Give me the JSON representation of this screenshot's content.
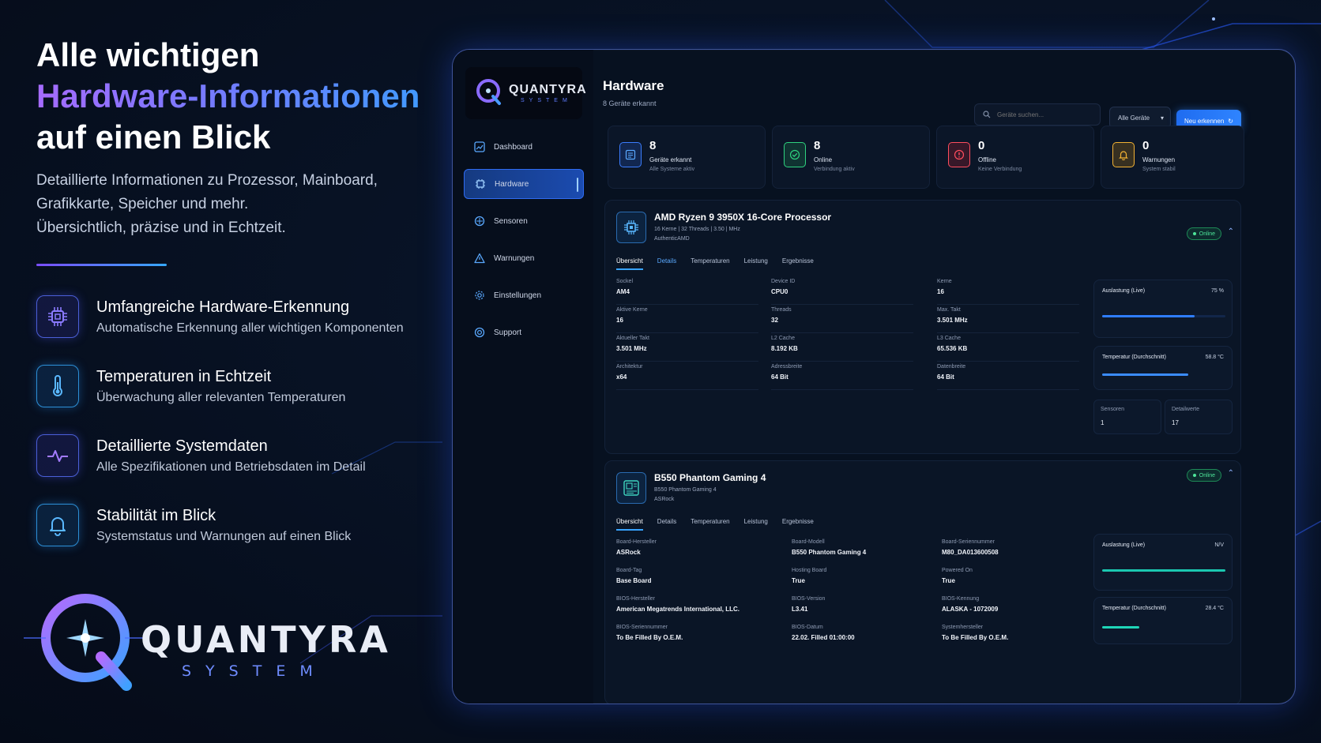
{
  "hero": {
    "line1": "Alle wichtigen",
    "line2": "Hardware-Informationen",
    "line3": "auf einen Blick",
    "sub1": "Detaillierte Informationen zu Prozessor, Mainboard,",
    "sub2": "Grafikkarte, Speicher und mehr.",
    "sub3": "Übersichtlich, präzise und in Echtzeit."
  },
  "features": [
    {
      "icon": "cpu-icon",
      "title": "Umfangreiche Hardware-Erkennung",
      "desc": "Automatische Erkennung aller wichtigen Komponenten"
    },
    {
      "icon": "thermometer-icon",
      "title": "Temperaturen in Echtzeit",
      "desc": "Überwachung aller relevanten Temperaturen"
    },
    {
      "icon": "pulse-icon",
      "title": "Detaillierte Systemdaten",
      "desc": "Alle Spezifikationen und Betriebsdaten im Detail"
    },
    {
      "icon": "bell-icon",
      "title": "Stabilität im Blick",
      "desc": "Systemstatus und Warnungen auf einen Blick"
    }
  ],
  "brand": {
    "name": "QUANTYRA",
    "tagline": "SYSTEM"
  },
  "app": {
    "logo_name": "QUANTYRA",
    "logo_sub": "SYSTEM",
    "nav": [
      {
        "icon": "dashboard-icon",
        "label": "Dashboard"
      },
      {
        "icon": "chip-icon",
        "label": "Hardware"
      },
      {
        "icon": "sensor-icon",
        "label": "Sensoren"
      },
      {
        "icon": "warning-icon",
        "label": "Warnungen"
      },
      {
        "icon": "gear-icon",
        "label": "Einstellungen"
      },
      {
        "icon": "support-icon",
        "label": "Support"
      }
    ],
    "title": "Hardware",
    "subtitle": "8 Geräte erkannt",
    "search_placeholder": "Geräte suchen...",
    "filter_label": "Alle Geräte",
    "rescan_label": "Neu erkennen",
    "stats": [
      {
        "icon": "list-icon",
        "value": "8",
        "label": "Geräte erkannt",
        "sub": "Alle Systeme aktiv",
        "color": "#3b7dff"
      },
      {
        "icon": "check-icon",
        "value": "8",
        "label": "Online",
        "sub": "Verbindung aktiv",
        "color": "#2fd27f"
      },
      {
        "icon": "alert-icon",
        "value": "0",
        "label": "Offline",
        "sub": "Keine Verbindung",
        "color": "#ff4d5e"
      },
      {
        "icon": "bell-icon",
        "value": "0",
        "label": "Warnungen",
        "sub": "System stabil",
        "color": "#f2b233"
      }
    ],
    "cards": [
      {
        "title": "AMD Ryzen 9 3950X 16-Core Processor",
        "meta": "16 Kerne | 32 Threads | 3.50 | MHz",
        "vendor": "AuthenticAMD",
        "status": "Online",
        "tabs": [
          "Übersicht",
          "Details",
          "Temperaturen",
          "Leistung",
          "Ergebnisse"
        ],
        "columns": [
          [
            {
              "label": "Sockel",
              "value": "AM4"
            },
            {
              "label": "Aktive Kerne",
              "value": "16"
            },
            {
              "label": "Aktueller Takt",
              "value": "3.501 MHz"
            },
            {
              "label": "Architektur",
              "value": "x64"
            }
          ],
          [
            {
              "label": "Device ID",
              "value": "CPU0"
            },
            {
              "label": "Threads",
              "value": "32"
            },
            {
              "label": "L2 Cache",
              "value": "8.192 KB"
            },
            {
              "label": "Adressbreite",
              "value": "64 Bit"
            }
          ],
          [
            {
              "label": "Kerne",
              "value": "16"
            },
            {
              "label": "Max. Takt",
              "value": "3.501 MHz"
            },
            {
              "label": "L3 Cache",
              "value": "65.536 KB"
            },
            {
              "label": "Datenbreite",
              "value": "64 Bit"
            }
          ]
        ],
        "load_label": "Auslastung (Live)",
        "load_value": "75 %",
        "load_fraction": 0.75,
        "temp_label": "Temperatur (Durchschnitt)",
        "temp_value": "58.8 °C",
        "temp_fraction": 0.7,
        "sensors_label": "Sensoren",
        "sensors_value": "1",
        "detail_label": "Detailwerte",
        "detail_value": "17"
      },
      {
        "title": "B550 Phantom Gaming 4",
        "meta": "B550 Phantom Gaming 4",
        "vendor": "ASRock",
        "status": "Online",
        "tabs": [
          "Übersicht",
          "Details",
          "Temperaturen",
          "Leistung",
          "Ergebnisse"
        ],
        "columns": [
          [
            {
              "label": "Board-Hersteller",
              "value": "ASRock"
            },
            {
              "label": "Board-Tag",
              "value": "Base Board"
            },
            {
              "label": "BIOS-Hersteller",
              "value": "American Megatrends International, LLC."
            },
            {
              "label": "BIOS-Seriennummer",
              "value": "To Be Filled By O.E.M."
            }
          ],
          [
            {
              "label": "Board-Modell",
              "value": "B550 Phantom Gaming 4"
            },
            {
              "label": "Hosting Board",
              "value": "True"
            },
            {
              "label": "BIOS-Version",
              "value": "L3.41"
            },
            {
              "label": "BIOS-Datum",
              "value": "22.02. Filled 01:00:00"
            }
          ],
          [
            {
              "label": "Board-Seriennummer",
              "value": "M80_DA013600508"
            },
            {
              "label": "Powered On",
              "value": "True"
            },
            {
              "label": "BIOS-Kennung",
              "value": "ALASKA - 1072009"
            },
            {
              "label": "Systemhersteller",
              "value": "To Be Filled By O.E.M."
            }
          ]
        ],
        "load_label": "Auslastung (Live)",
        "load_value": "N/V",
        "temp_label": "Temperatur (Durchschnitt)",
        "temp_value": "28.4 °C",
        "temp_fraction": 0.3
      }
    ]
  }
}
